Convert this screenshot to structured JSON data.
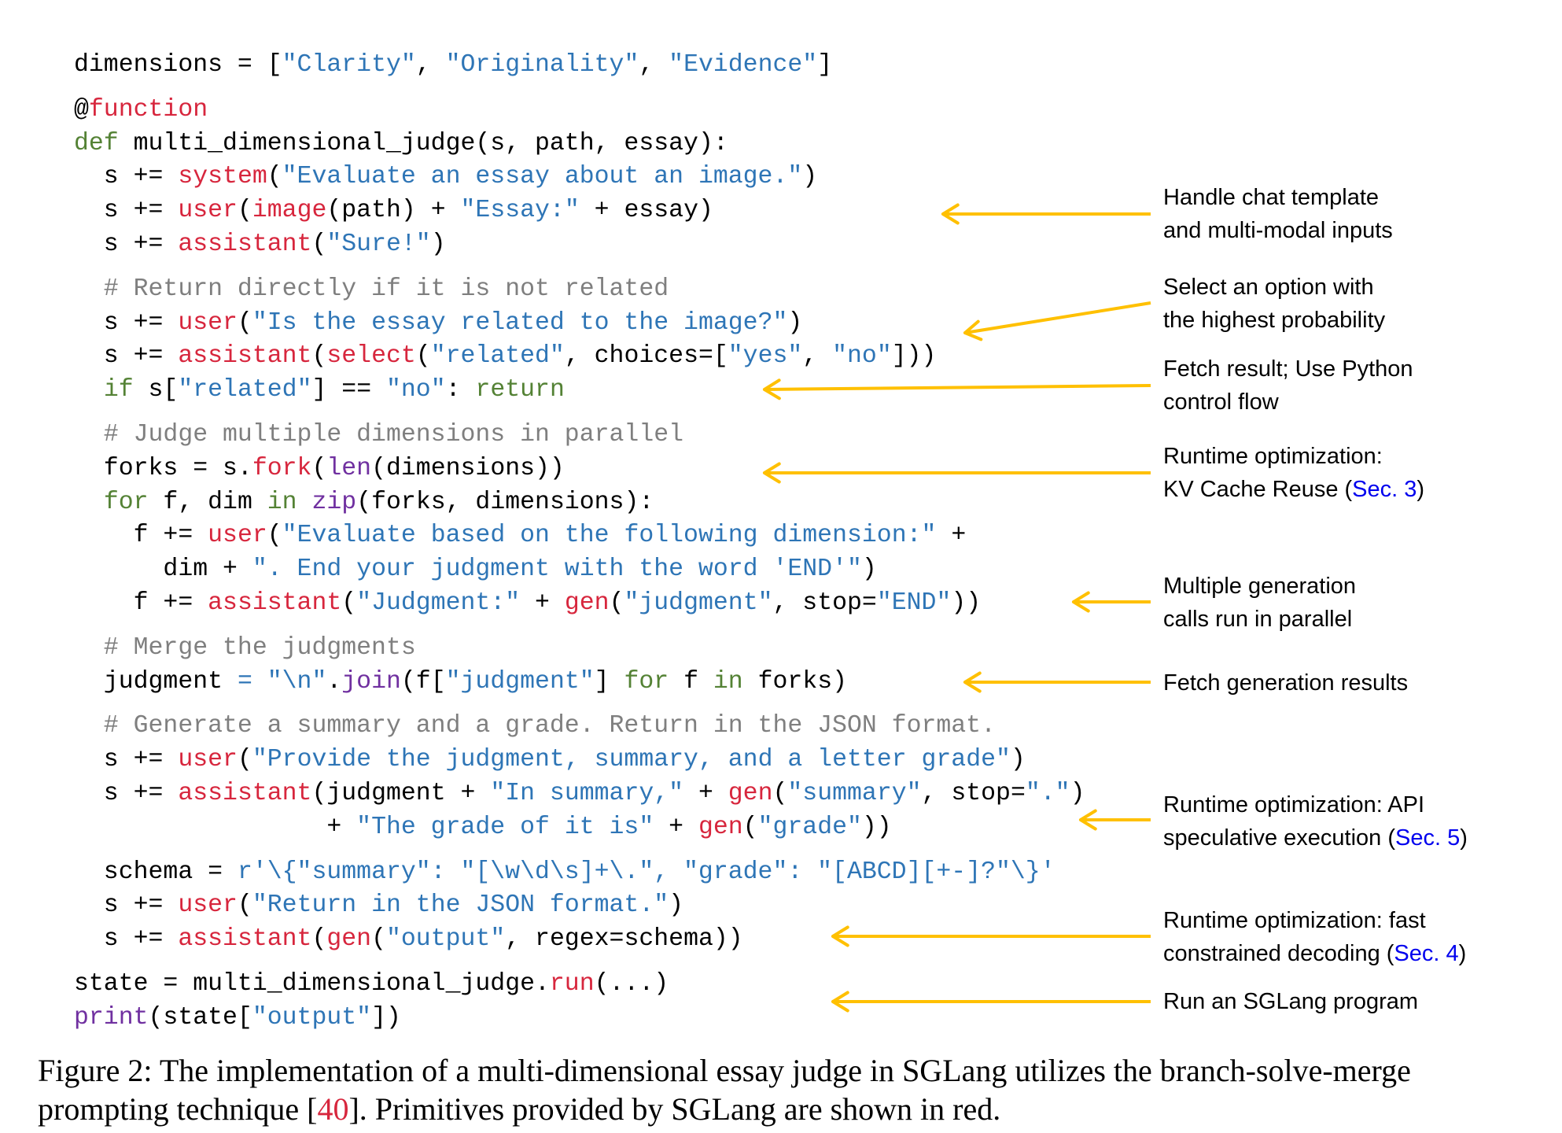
{
  "code_lines": [
    {
      "gap": false,
      "tokens": [
        [
          "dimensions = [",
          "k"
        ],
        [
          "\"Clarity\"",
          "b"
        ],
        [
          ", ",
          "k"
        ],
        [
          "\"Originality\"",
          "b"
        ],
        [
          ", ",
          "k"
        ],
        [
          "\"Evidence\"",
          "b"
        ],
        [
          "]",
          "k"
        ]
      ]
    },
    {
      "gap": true,
      "tokens": [
        [
          "@",
          "k"
        ],
        [
          "function",
          "r"
        ]
      ]
    },
    {
      "gap": false,
      "tokens": [
        [
          "def",
          "g"
        ],
        [
          " multi_dimensional_judge(s, path, essay):",
          "k"
        ]
      ]
    },
    {
      "gap": false,
      "tokens": [
        [
          "  s += ",
          "k"
        ],
        [
          "system",
          "r"
        ],
        [
          "(",
          "k"
        ],
        [
          "\"Evaluate an essay about an image.\"",
          "b"
        ],
        [
          ")",
          "k"
        ]
      ]
    },
    {
      "gap": false,
      "tokens": [
        [
          "  s += ",
          "k"
        ],
        [
          "user",
          "r"
        ],
        [
          "(",
          "k"
        ],
        [
          "image",
          "r"
        ],
        [
          "(path) + ",
          "k"
        ],
        [
          "\"Essay:\"",
          "b"
        ],
        [
          " + essay)",
          "k"
        ]
      ]
    },
    {
      "gap": false,
      "tokens": [
        [
          "  s += ",
          "k"
        ],
        [
          "assistant",
          "r"
        ],
        [
          "(",
          "k"
        ],
        [
          "\"Sure!\"",
          "b"
        ],
        [
          ")",
          "k"
        ]
      ]
    },
    {
      "gap": true,
      "tokens": [
        [
          "  # Return directly if it is not related",
          "m"
        ]
      ]
    },
    {
      "gap": false,
      "tokens": [
        [
          "  s += ",
          "k"
        ],
        [
          "user",
          "r"
        ],
        [
          "(",
          "k"
        ],
        [
          "\"Is the essay related to the image?\"",
          "b"
        ],
        [
          ")",
          "k"
        ]
      ]
    },
    {
      "gap": false,
      "tokens": [
        [
          "  s += ",
          "k"
        ],
        [
          "assistant",
          "r"
        ],
        [
          "(",
          "k"
        ],
        [
          "select",
          "r"
        ],
        [
          "(",
          "k"
        ],
        [
          "\"related\"",
          "b"
        ],
        [
          ", choices=[",
          "k"
        ],
        [
          "\"yes\"",
          "b"
        ],
        [
          ", ",
          "k"
        ],
        [
          "\"no\"",
          "b"
        ],
        [
          "]))",
          "k"
        ]
      ]
    },
    {
      "gap": false,
      "tokens": [
        [
          "  ",
          "k"
        ],
        [
          "if",
          "g"
        ],
        [
          " s[",
          "k"
        ],
        [
          "\"related\"",
          "b"
        ],
        [
          "] == ",
          "k"
        ],
        [
          "\"no\"",
          "b"
        ],
        [
          ": ",
          "k"
        ],
        [
          "return",
          "g"
        ]
      ]
    },
    {
      "gap": true,
      "tokens": [
        [
          "  # Judge multiple dimensions in parallel",
          "m"
        ]
      ]
    },
    {
      "gap": false,
      "tokens": [
        [
          "  forks = s.",
          "k"
        ],
        [
          "fork",
          "r"
        ],
        [
          "(",
          "k"
        ],
        [
          "len",
          "p"
        ],
        [
          "(dimensions))",
          "k"
        ]
      ]
    },
    {
      "gap": false,
      "tokens": [
        [
          "  ",
          "k"
        ],
        [
          "for",
          "g"
        ],
        [
          " f, dim ",
          "k"
        ],
        [
          "in",
          "g"
        ],
        [
          " ",
          "k"
        ],
        [
          "zip",
          "p"
        ],
        [
          "(forks, dimensions):",
          "k"
        ]
      ]
    },
    {
      "gap": false,
      "tokens": [
        [
          "    f += ",
          "k"
        ],
        [
          "user",
          "r"
        ],
        [
          "(",
          "k"
        ],
        [
          "\"Evaluate based on the following dimension:\"",
          "b"
        ],
        [
          " +",
          "k"
        ]
      ]
    },
    {
      "gap": false,
      "tokens": [
        [
          "      dim + ",
          "k"
        ],
        [
          "\". End your judgment with the word 'END'\"",
          "b"
        ],
        [
          ")",
          "k"
        ]
      ]
    },
    {
      "gap": false,
      "tokens": [
        [
          "    f += ",
          "k"
        ],
        [
          "assistant",
          "r"
        ],
        [
          "(",
          "k"
        ],
        [
          "\"Judgment:\"",
          "b"
        ],
        [
          " + ",
          "k"
        ],
        [
          "gen",
          "r"
        ],
        [
          "(",
          "k"
        ],
        [
          "\"judgment\"",
          "b"
        ],
        [
          ", stop=",
          "k"
        ],
        [
          "\"END\"",
          "b"
        ],
        [
          "))",
          "k"
        ]
      ]
    },
    {
      "gap": true,
      "tokens": [
        [
          "  # Merge the judgments",
          "m"
        ]
      ]
    },
    {
      "gap": false,
      "tokens": [
        [
          "  judgment ",
          "k"
        ],
        [
          "=",
          "b"
        ],
        [
          " ",
          "k"
        ],
        [
          "\"\\n\"",
          "b"
        ],
        [
          ".",
          "k"
        ],
        [
          "join",
          "p"
        ],
        [
          "(f[",
          "k"
        ],
        [
          "\"judgment\"",
          "b"
        ],
        [
          "] ",
          "k"
        ],
        [
          "for",
          "g"
        ],
        [
          " f ",
          "k"
        ],
        [
          "in",
          "g"
        ],
        [
          " forks)",
          "k"
        ]
      ]
    },
    {
      "gap": true,
      "tokens": [
        [
          "  # Generate a summary and a grade. Return in the JSON format.",
          "m"
        ]
      ]
    },
    {
      "gap": false,
      "tokens": [
        [
          "  s += ",
          "k"
        ],
        [
          "user",
          "r"
        ],
        [
          "(",
          "k"
        ],
        [
          "\"Provide the judgment, summary, and a letter grade\"",
          "b"
        ],
        [
          ")",
          "k"
        ]
      ]
    },
    {
      "gap": false,
      "tokens": [
        [
          "  s += ",
          "k"
        ],
        [
          "assistant",
          "r"
        ],
        [
          "(judgment + ",
          "k"
        ],
        [
          "\"In summary,\"",
          "b"
        ],
        [
          " + ",
          "k"
        ],
        [
          "gen",
          "r"
        ],
        [
          "(",
          "k"
        ],
        [
          "\"summary\"",
          "b"
        ],
        [
          ", stop=",
          "k"
        ],
        [
          "\".\"",
          "b"
        ],
        [
          ")",
          "k"
        ]
      ]
    },
    {
      "gap": false,
      "tokens": [
        [
          "                 + ",
          "k"
        ],
        [
          "\"The grade of it is\"",
          "b"
        ],
        [
          " + ",
          "k"
        ],
        [
          "gen",
          "r"
        ],
        [
          "(",
          "k"
        ],
        [
          "\"grade\"",
          "b"
        ],
        [
          "))",
          "k"
        ]
      ]
    },
    {
      "gap": true,
      "tokens": [
        [
          "  schema = ",
          "k"
        ],
        [
          "r'\\{\"summary\": \"[\\w\\d\\s]+\\.\", \"grade\": \"[ABCD][+-]?\"\\}'",
          "b"
        ]
      ]
    },
    {
      "gap": false,
      "tokens": [
        [
          "  s += ",
          "k"
        ],
        [
          "user",
          "r"
        ],
        [
          "(",
          "k"
        ],
        [
          "\"Return in the JSON format.\"",
          "b"
        ],
        [
          ")",
          "k"
        ]
      ]
    },
    {
      "gap": false,
      "tokens": [
        [
          "  s += ",
          "k"
        ],
        [
          "assistant",
          "r"
        ],
        [
          "(",
          "k"
        ],
        [
          "gen",
          "r"
        ],
        [
          "(",
          "k"
        ],
        [
          "\"output\"",
          "b"
        ],
        [
          ", regex=schema))",
          "k"
        ]
      ]
    },
    {
      "gap": true,
      "tokens": [
        [
          "state = multi_dimensional_judge.",
          "k"
        ],
        [
          "run",
          "r"
        ],
        [
          "(...)",
          "k"
        ]
      ]
    },
    {
      "gap": false,
      "tokens": [
        [
          "print",
          "p"
        ],
        [
          "(state[",
          "k"
        ],
        [
          "\"output\"",
          "b"
        ],
        [
          "])",
          "k"
        ]
      ]
    }
  ],
  "annotations": {
    "a1": {
      "l1": "Handle chat template",
      "l2": "and multi-modal inputs"
    },
    "a2": {
      "l1": "Select an option with",
      "l2": "the highest probability"
    },
    "a3": {
      "l1": "Fetch result; Use Python",
      "l2": "control flow"
    },
    "a4": {
      "l1": "Runtime optimization:",
      "l2": "KV Cache Reuse (",
      "sec": "Sec. 3",
      "end": ")"
    },
    "a5": {
      "l1": "Multiple generation",
      "l2": "calls run in parallel"
    },
    "a6": {
      "l1": "Fetch generation results"
    },
    "a7": {
      "l1": "Runtime optimization: API",
      "l2": "speculative execution (",
      "sec": "Sec. 5",
      "end": ")"
    },
    "a8": {
      "l1": "Runtime optimization: fast",
      "l2": "constrained decoding (",
      "sec": "Sec. 4",
      "end": ")"
    },
    "a9": {
      "l1": "Run an SGLang program"
    }
  },
  "caption": {
    "label": "Figure 2:",
    "text1": " The implementation of a multi-dimensional essay judge in SGLang utilizes the branch-solve-merge prompting technique [",
    "ref": "40",
    "text2": "]. Primitives provided by SGLang are shown in red."
  },
  "colors": {
    "arrow": "#ffc000",
    "primitive": "#d7263d",
    "string": "#2e75b6",
    "keyword": "#548235",
    "builtin": "#7030a0",
    "comment": "#7f7f7f",
    "link": "#0000ee"
  }
}
